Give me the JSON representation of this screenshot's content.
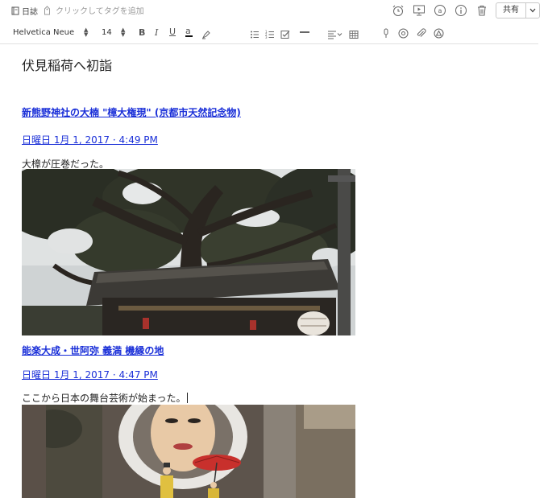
{
  "toolbar": {
    "notebook_label": "日誌",
    "tag_placeholder": "クリックしてタグを追加",
    "share_label": "共有"
  },
  "format_bar": {
    "font_name": "Helvetica Neue",
    "font_size": "14"
  },
  "note": {
    "title": "伏見稲荷へ初詣",
    "entries": [
      {
        "link": "新熊野神社の大楠 \"樟大権現\" (京都市天然記念物)",
        "date": "日曜日 1月 1, 2017 · 4:49 PM",
        "body": "大樟が圧巻だった。"
      },
      {
        "link": "能楽大成・世阿弥 義満 機縁の地",
        "date": "日曜日 1月 1, 2017 · 4:47 PM",
        "body": "ここから日本の舞台芸術が始まった。"
      }
    ]
  },
  "colors": {
    "link": "#1a2fd8",
    "text": "#222222",
    "toolbar_icon": "#666666"
  }
}
